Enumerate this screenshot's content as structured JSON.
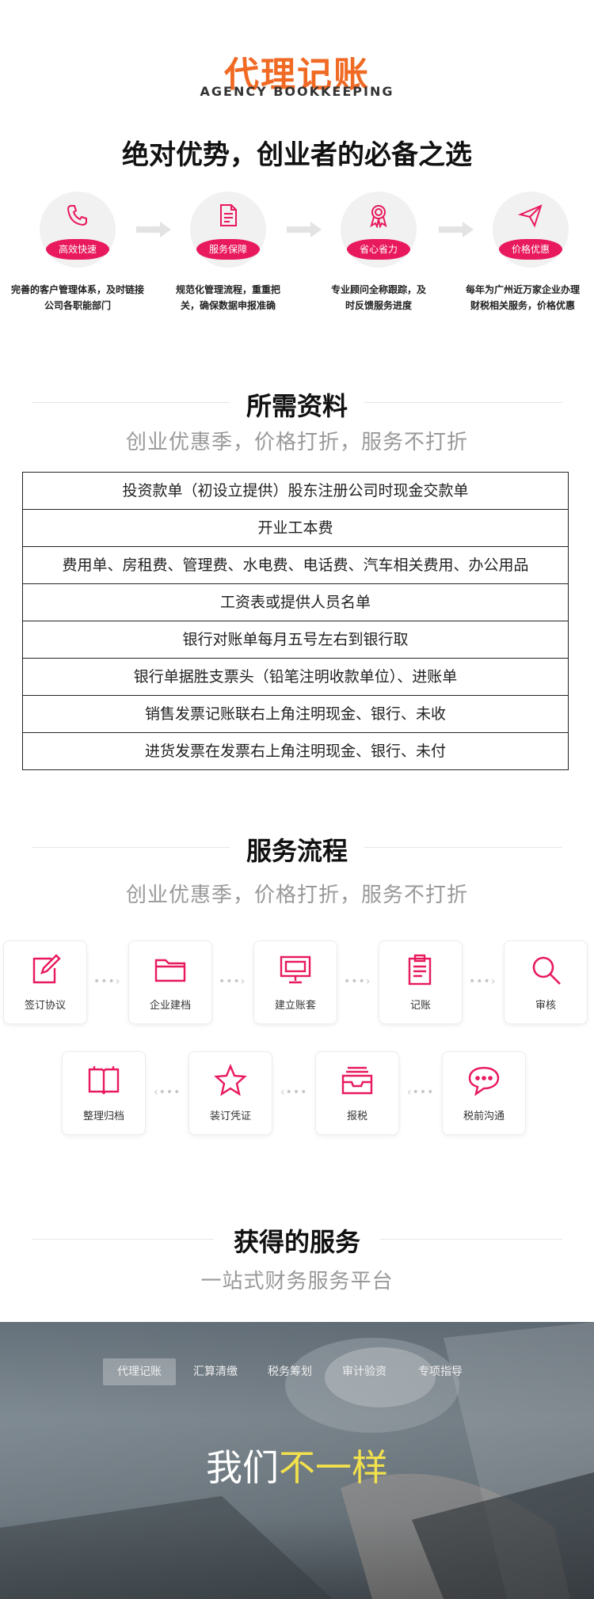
{
  "header": {
    "title": "代理记账",
    "subtitle": "AGENCY BOOKKEEPING"
  },
  "advantages": {
    "heading": "绝对优势，创业者的必备之选",
    "items": [
      {
        "badge": "高效快速",
        "icon": "phone-icon",
        "desc_line1": "完善的客户管理体系，及时链接",
        "desc_line2": "公司各职能部门"
      },
      {
        "badge": "服务保障",
        "icon": "document-icon",
        "desc_line1": "规范化管理流程，重重把",
        "desc_line2": "关，确保数据申报准确"
      },
      {
        "badge": "省心省力",
        "icon": "award-icon",
        "desc_line1": "专业顾问全称跟踪，及",
        "desc_line2": "时反馈服务进度"
      },
      {
        "badge": "价格优惠",
        "icon": "send-icon",
        "desc_line1": "每年为广州近万家企业办理",
        "desc_line2": "财税相关服务，价格优惠"
      }
    ]
  },
  "materials": {
    "title": "所需资料",
    "subtitle": "创业优惠季，价格打折，服务不打折",
    "rows": [
      "投资款单（初设立提供）股东注册公司时现金交款单",
      "开业工本费",
      "费用单、房租费、管理费、水电费、电话费、汽车相关费用、办公用品",
      "工资表或提供人员名单",
      "银行对账单每月五号左右到银行取",
      "银行单据胜支票头（铅笔注明收款单位）、进账单",
      "销售发票记账联右上角注明现金、银行、未收",
      "进货发票在发票右上角注明现金、银行、未付"
    ]
  },
  "process": {
    "title": "服务流程",
    "subtitle": "创业优惠季，价格打折，服务不打折",
    "row1": [
      "签订协议",
      "企业建档",
      "建立账套",
      "记账",
      "审核"
    ],
    "row2": [
      "整理归档",
      "装订凭证",
      "报税",
      "税前沟通"
    ],
    "arrow_forward": "•••›",
    "arrow_back": "‹•••"
  },
  "services": {
    "title": "获得的服务",
    "subtitle": "一站式财务服务平台"
  },
  "banner": {
    "tabs": [
      "代理记账",
      "汇算清缴",
      "税务筹划",
      "审计验资",
      "专项指导"
    ],
    "active_tab": "代理记账",
    "slogan_white": "我们",
    "slogan_yellow": "不一样"
  },
  "colors": {
    "orange": "#f06a24",
    "pink": "#e8195c",
    "yellow": "#f2e14c"
  }
}
